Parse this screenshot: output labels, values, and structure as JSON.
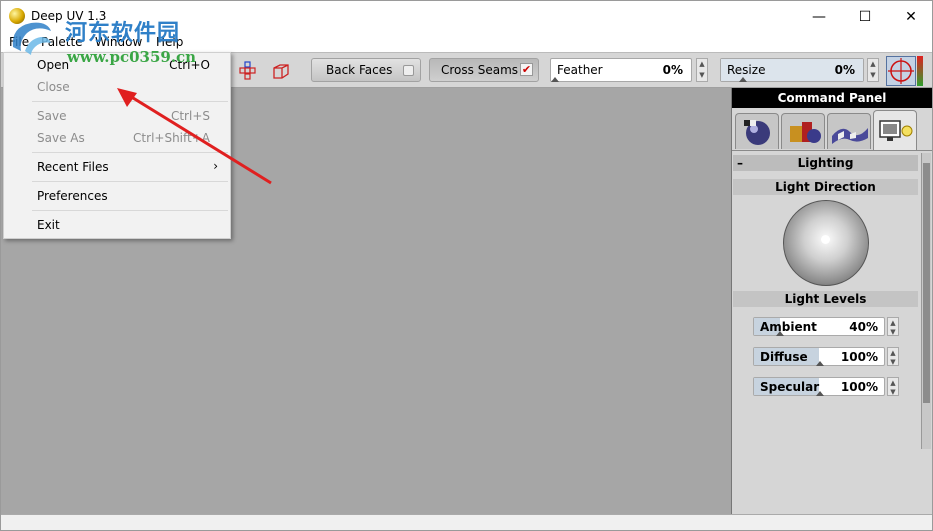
{
  "window": {
    "title": "Deep UV 1.3",
    "controls": {
      "minimize": "—",
      "maximize": "☐",
      "close": "✕"
    }
  },
  "menubar": {
    "items": [
      {
        "label": "File"
      },
      {
        "label": "Palette"
      },
      {
        "label": "Window"
      },
      {
        "label": "Help"
      }
    ]
  },
  "file_menu": {
    "items": [
      {
        "label": "Open",
        "shortcut": "Ctrl+O",
        "enabled": true
      },
      {
        "label": "Close",
        "shortcut": "",
        "enabled": false
      },
      {
        "label": "Save",
        "shortcut": "Ctrl+S",
        "enabled": false
      },
      {
        "label": "Save As",
        "shortcut": "Ctrl+Shift+A",
        "enabled": false
      },
      {
        "label": "Recent Files",
        "submenu_arrow": "›",
        "enabled": true
      },
      {
        "label": "Preferences",
        "enabled": true
      },
      {
        "label": "Exit",
        "enabled": true
      }
    ]
  },
  "toolbar": {
    "back_faces": {
      "label": "Back Faces",
      "checked": false
    },
    "cross_seams": {
      "label": "Cross Seams",
      "checked": true,
      "check_glyph": "✔"
    },
    "feather": {
      "label": "Feather",
      "value": "0%",
      "fraction": 0.0
    },
    "resize": {
      "label": "Resize",
      "value": "0%",
      "fraction": 0.0
    }
  },
  "command_panel": {
    "title": "Command Panel",
    "tabs": [
      "materials-tab-icon",
      "objects-tab-icon",
      "uv-tab-icon",
      "display-tab-icon"
    ],
    "section": {
      "collapse_glyph": "–",
      "title": "Lighting"
    },
    "light_direction": {
      "title": "Light Direction"
    },
    "light_levels": {
      "title": "Light Levels",
      "ambient": {
        "label": "Ambient",
        "value": "40%",
        "fraction": 0.4
      },
      "diffuse": {
        "label": "Diffuse",
        "value": "100%",
        "fraction": 1.0
      },
      "specular": {
        "label": "Specular",
        "value": "100%",
        "fraction": 1.0
      }
    }
  },
  "watermark": {
    "text": "河东软件园",
    "url": "www.pc0359.cn"
  },
  "colors": {
    "viewport": "#a6a6a6",
    "panel_title_bg": "#000000",
    "annotation_arrow": "#e02020",
    "watermark_blue": "#2f80c8",
    "watermark_green": "#3aa645"
  }
}
